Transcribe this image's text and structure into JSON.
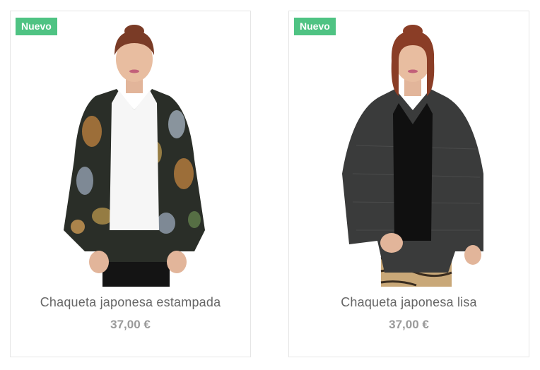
{
  "products": [
    {
      "badge": "Nuevo",
      "name": "Chaqueta japonesa estampada",
      "price": "37,00 €"
    },
    {
      "badge": "Nuevo",
      "name": "Chaqueta japonesa lisa",
      "price": "37,00 €"
    }
  ],
  "colors": {
    "badge_bg": "#4fc383",
    "name_text": "#666666",
    "price_text": "#9a9a9a",
    "card_border": "#e6e6e6"
  }
}
